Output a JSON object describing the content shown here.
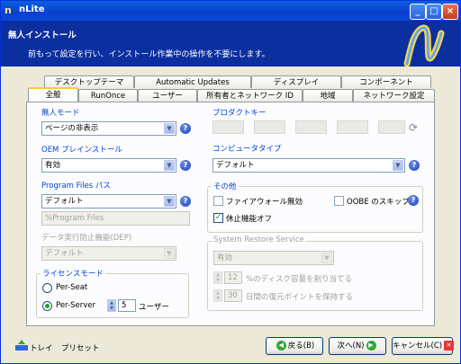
{
  "window": {
    "title": "nLite",
    "icon": "nlite-n-icon",
    "controls": {
      "minimize": "_",
      "maximize": "□",
      "close": "×"
    }
  },
  "header": {
    "title": "無人インストール",
    "subtitle": "前もって設定を行い、インストール作業中の操作を不要にします。"
  },
  "tabs_back": [
    "デスクトップテーマ",
    "Automatic Updates",
    "ディスプレイ",
    "コンポーネント"
  ],
  "tabs_front": [
    "全般",
    "RunOnce",
    "ユーザー",
    "所有者とネットワーク ID",
    "地域",
    "ネットワーク設定"
  ],
  "active_tab": "全般",
  "general": {
    "unattended_mode": {
      "legend": "無人モード",
      "value": "ページの非表示"
    },
    "oem_preinstall": {
      "legend": "OEM プレインストール",
      "value": "有効"
    },
    "program_files": {
      "legend": "Program Files パス",
      "value": "デフォルト",
      "path_value": "%Program Files"
    },
    "dep": {
      "legend": "データ実行防止機能(DEP)",
      "value": "デフォルト"
    },
    "license_mode": {
      "legend": "ライセンスモード",
      "per_seat": "Per-Seat",
      "per_server": "Per-Server",
      "selected": "Per-Server",
      "users_count": "5",
      "users_label": "ユーザー"
    },
    "product_key": {
      "legend": "プロダクトキー",
      "segments": [
        "",
        "",
        "",
        "",
        ""
      ]
    },
    "computer_type": {
      "legend": "コンピュータタイプ",
      "value": "デフォルト"
    },
    "other": {
      "legend": "その他",
      "firewall_disable": {
        "label": "ファイアウォール無効",
        "checked": false
      },
      "oobe_skip": {
        "label": "OOBE のスキップ",
        "checked": false
      },
      "hibernate_off": {
        "label": "休止機能オフ",
        "checked": true
      }
    },
    "system_restore": {
      "legend": "System Restore Service",
      "value": "有効",
      "disk_percent": "12",
      "disk_label": "%のディスク容量を割り当てる",
      "days": "30",
      "days_label": "日間の復元ポイントを保持する"
    }
  },
  "footer": {
    "tray": "トレイ",
    "preset": "プリセット",
    "back": "戻る(B)",
    "next": "次へ(N)",
    "cancel": "キャンセル(C)"
  },
  "icons": {
    "help": "?",
    "dropdown": "▼",
    "check": "✓",
    "spin_up": "▲",
    "spin_down": "▼",
    "refresh": "⟳",
    "back_arrow": "◀",
    "next_arrow": "▶",
    "cancel_x": "✕"
  },
  "colors": {
    "title_bar": "#0a46d8",
    "header_bg": "#0b2f9f",
    "legend_text": "#0046d5",
    "tab_highlight": "#ffc83c",
    "check_green": "#21a121"
  }
}
